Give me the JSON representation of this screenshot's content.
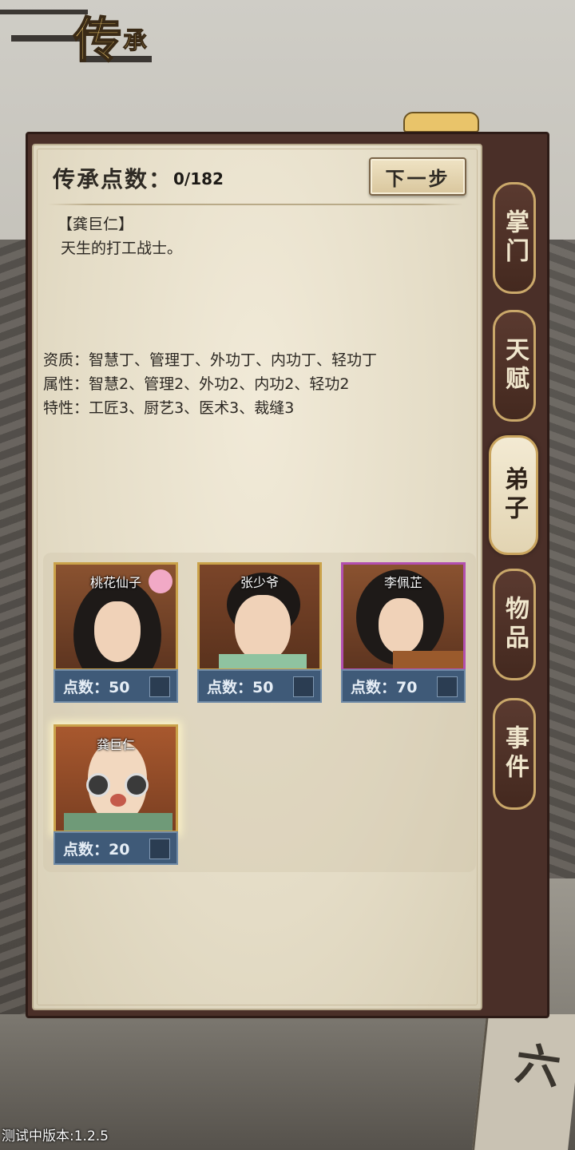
{
  "header": {
    "title_main": "传",
    "title_sub": "承"
  },
  "panel": {
    "points_label": "传承点数：",
    "points_value": "0/182",
    "next_button": "下一步",
    "selected_character": {
      "name": "【龚巨仁】",
      "description": "天生的打工战士。",
      "aptitude": "资质：智慧丁、管理丁、外功丁、内功丁、轻功丁",
      "attributes": "属性：智慧2、管理2、外功2、内功2、轻功2",
      "traits": "特性：工匠3、厨艺3、医术3、裁缝3"
    }
  },
  "cards": [
    {
      "name": "桃花仙子",
      "cost": "点数：50",
      "frame": "gold"
    },
    {
      "name": "张少爷",
      "cost": "点数：50",
      "frame": "gold"
    },
    {
      "name": "李佩芷",
      "cost": "点数：70",
      "frame": "purple"
    },
    {
      "name": "龚巨仁",
      "cost": "点数：20",
      "frame": "gold",
      "selected": true
    }
  ],
  "tabs": [
    {
      "label": "掌门",
      "active": false
    },
    {
      "label": "天赋",
      "active": false
    },
    {
      "label": "弟子",
      "active": true
    },
    {
      "label": "物品",
      "active": false
    },
    {
      "label": "事件",
      "active": false
    }
  ],
  "footer": {
    "version": "测试中版本:1.2.5"
  },
  "poster": {
    "text": "六"
  },
  "colors": {
    "frame": "#4a2f28",
    "paper": "#e8e0cb",
    "cost_bar": "#3f5a78",
    "gold_border": "#caa24a",
    "purple_border": "#b24fb0"
  }
}
